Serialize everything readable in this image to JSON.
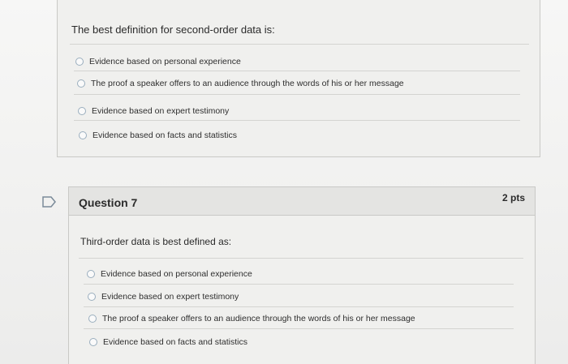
{
  "question_prev": {
    "text": "The best definition for second-order data is:",
    "answers": [
      "Evidence based on personal experience",
      "The proof a speaker offers to an audience through the words of his or her message",
      "Evidence based on expert testimony",
      "Evidence based on facts and statistics"
    ]
  },
  "question7": {
    "title": "Question 7",
    "points": "2 pts",
    "text": "Third-order data is best defined as:",
    "answers": [
      "Evidence based on personal experience",
      "Evidence based on expert testimony",
      "The proof a speaker offers to an audience through the words of his or her message",
      "Evidence based on facts and statistics"
    ]
  },
  "icons": {
    "flag": "flag-icon",
    "radio": "radio-button-icon"
  }
}
